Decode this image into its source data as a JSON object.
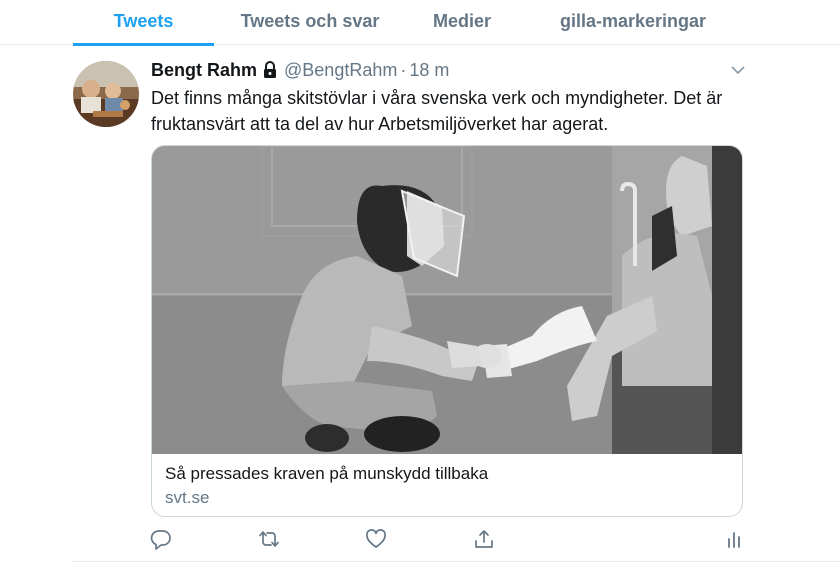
{
  "tabs": [
    {
      "label": "Tweets",
      "active": true
    },
    {
      "label": "Tweets och svar",
      "active": false
    },
    {
      "label": "Medier",
      "active": false
    },
    {
      "label": "gilla-markeringar",
      "active": false
    }
  ],
  "tweet": {
    "author_name": "Bengt Rahm",
    "protected_icon": "lock-icon",
    "handle": "@BengtRahm",
    "separator": "·",
    "time": "18 m",
    "text": "Det finns många skitstövlar i våra svenska verk och myndigheter. Det är fruktansvärt att ta del av hur Arbetsmiljöverket har agerat.",
    "card": {
      "title": "Så pressades kraven på munskydd tillbaka",
      "domain": "svt.se"
    }
  },
  "actions": [
    "reply-icon",
    "retweet-icon",
    "like-icon",
    "share-icon",
    "analytics-icon"
  ],
  "colors": {
    "accent": "#1da1f2",
    "secondary_text": "#657786",
    "primary_text": "#14171a",
    "divider": "#e6ecf0"
  }
}
